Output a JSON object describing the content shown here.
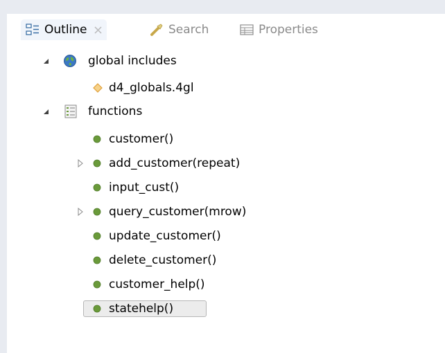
{
  "tabs": [
    {
      "label": "Outline",
      "icon": "outline-icon",
      "active": true
    },
    {
      "label": "Search",
      "icon": "search-flashlight-icon",
      "active": false
    },
    {
      "label": "Properties",
      "icon": "properties-icon",
      "active": false
    }
  ],
  "tree": {
    "global_includes": {
      "label": "global includes",
      "icon": "globe-icon",
      "expanded": true,
      "children": [
        {
          "label": "d4_globals.4gl",
          "icon": "diamond-icon"
        }
      ]
    },
    "functions": {
      "label": "functions",
      "icon": "functions-list-icon",
      "expanded": true,
      "children": [
        {
          "label": "customer()",
          "expandable": false
        },
        {
          "label": "add_customer(repeat)",
          "expandable": true
        },
        {
          "label": "input_cust()",
          "expandable": false
        },
        {
          "label": "query_customer(mrow)",
          "expandable": true
        },
        {
          "label": "update_customer()",
          "expandable": false
        },
        {
          "label": "delete_customer()",
          "expandable": false
        },
        {
          "label": "customer_help()",
          "expandable": false
        },
        {
          "label": "statehelp()",
          "expandable": false,
          "selected": true
        }
      ]
    }
  },
  "colors": {
    "function_dot": "#6a9a3a",
    "diamond": "#e8a33a",
    "selection_border": "#b6b6b6",
    "selection_fill": "#ececec",
    "chrome": "#e8ebf1"
  }
}
